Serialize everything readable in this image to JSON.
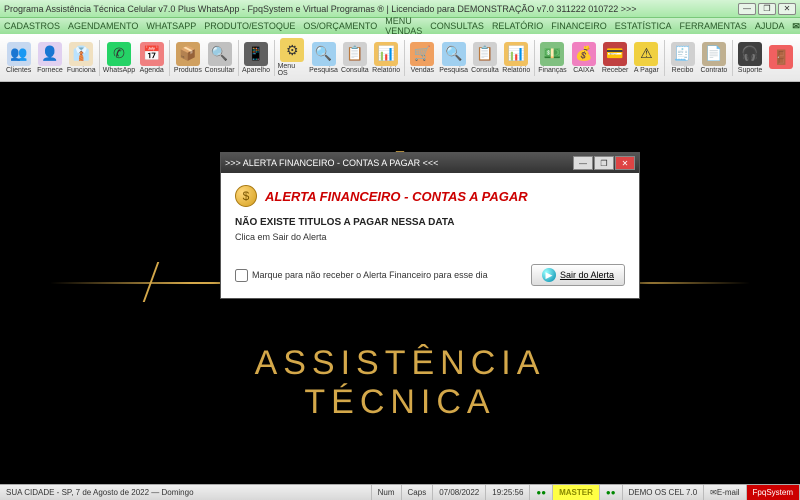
{
  "title": "Programa Assistência Técnica Celular v7.0 Plus WhatsApp - FpqSystem e Virtual Programas ® | Licenciado para DEMONSTRAÇÃO v7.0 311222 010722 >>>",
  "menu": [
    "CADASTROS",
    "AGENDAMENTO",
    "WHATSAPP",
    "PRODUTO/ESTOQUE",
    "OS/ORÇAMENTO",
    "MENU VENDAS",
    "CONSULTAS",
    "RELATÓRIO",
    "FINANCEIRO",
    "ESTATÍSTICA",
    "FERRAMENTAS",
    "AJUDA"
  ],
  "email_label": "E-MAIL",
  "toolbar": [
    {
      "label": "Clientes",
      "bg": "#c6d8f0",
      "glyph": "👥"
    },
    {
      "label": "Fornece",
      "bg": "#e0d0f0",
      "glyph": "👤"
    },
    {
      "label": "Funciona",
      "bg": "#f0e0c0",
      "glyph": "👔"
    },
    {
      "sep": true
    },
    {
      "label": "WhatsApp",
      "bg": "#25d366",
      "glyph": "✆"
    },
    {
      "label": "Agenda",
      "bg": "#f08080",
      "glyph": "📅"
    },
    {
      "sep": true
    },
    {
      "label": "Produtos",
      "bg": "#d0a060",
      "glyph": "📦"
    },
    {
      "label": "Consultar",
      "bg": "#c0c0c0",
      "glyph": "🔍"
    },
    {
      "sep": true
    },
    {
      "label": "Aparelho",
      "bg": "#606060",
      "glyph": "📱"
    },
    {
      "sep": true
    },
    {
      "label": "Menu OS",
      "bg": "#f0d060",
      "glyph": "⚙"
    },
    {
      "label": "Pesquisa",
      "bg": "#a0d0f0",
      "glyph": "🔍"
    },
    {
      "label": "Consulta",
      "bg": "#d0d0d0",
      "glyph": "📋"
    },
    {
      "label": "Relatório",
      "bg": "#f0c060",
      "glyph": "📊"
    },
    {
      "sep": true
    },
    {
      "label": "Vendas",
      "bg": "#f0a060",
      "glyph": "🛒"
    },
    {
      "label": "Pesquisa",
      "bg": "#a0d0f0",
      "glyph": "🔍"
    },
    {
      "label": "Consulta",
      "bg": "#d0d0d0",
      "glyph": "📋"
    },
    {
      "label": "Relatório",
      "bg": "#f0c060",
      "glyph": "📊"
    },
    {
      "sep": true
    },
    {
      "label": "Finanças",
      "bg": "#80c080",
      "glyph": "💵"
    },
    {
      "label": "CAIXA",
      "bg": "#f080c0",
      "glyph": "💰"
    },
    {
      "label": "Receber",
      "bg": "#c04040",
      "glyph": "💳"
    },
    {
      "label": "A Pagar",
      "bg": "#f0d040",
      "glyph": "⚠"
    },
    {
      "sep": true
    },
    {
      "label": "Recibo",
      "bg": "#d0d0d0",
      "glyph": "🧾"
    },
    {
      "label": "Contrato",
      "bg": "#c0b090",
      "glyph": "📄"
    },
    {
      "sep": true
    },
    {
      "label": "Suporte",
      "bg": "#404040",
      "glyph": "🎧"
    },
    {
      "label": "",
      "bg": "#f06060",
      "glyph": "🚪"
    }
  ],
  "bg_text": "ASSISTÊNCIA TÉCNICA",
  "dialog": {
    "title": ">>> ALERTA FINANCEIRO - CONTAS A PAGAR <<<",
    "heading": "ALERTA FINANCEIRO - CONTAS A PAGAR",
    "message": "NÃO EXISTE TITULOS A PAGAR NESSA DATA",
    "sub": "Clica em Sair do Alerta",
    "checkbox": "Marque para não receber o Alerta Financeiro para esse dia",
    "button": "Sair do Alerta"
  },
  "status": {
    "location": "SUA CIDADE - SP, 7 de Agosto de 2022 — Domingo",
    "num": "Num",
    "caps": "Caps",
    "date": "07/08/2022",
    "time": "19:25:56",
    "master": "MASTER",
    "demo": "DEMO OS CEL 7.0",
    "email": "E-mail",
    "fpq": "FpqSystem"
  }
}
